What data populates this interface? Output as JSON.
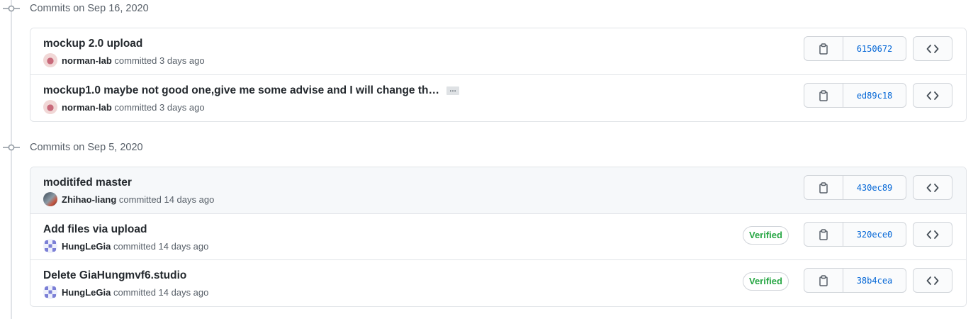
{
  "groups": [
    {
      "title": "Commits on Sep 16, 2020",
      "commits": [
        {
          "message": "mockup 2.0 upload",
          "has_ellipsis": false,
          "author": "norman-lab",
          "time": "committed 3 days ago",
          "avatar": "norman",
          "sha": "6150672",
          "verified": false,
          "highlight": false
        },
        {
          "message": "mockup1.0 maybe not good one,give me some advise and I will change th…",
          "has_ellipsis": true,
          "ellipsis_label": "…",
          "author": "norman-lab",
          "time": "committed 3 days ago",
          "avatar": "norman",
          "sha": "ed89c18",
          "verified": false,
          "highlight": false
        }
      ]
    },
    {
      "title": "Commits on Sep 5, 2020",
      "commits": [
        {
          "message": "moditifed master",
          "has_ellipsis": false,
          "author": "Zhihao-liang",
          "time": "committed 14 days ago",
          "avatar": "zhihao",
          "sha": "430ec89",
          "verified": false,
          "highlight": true
        },
        {
          "message": "Add files via upload",
          "has_ellipsis": false,
          "author": "HungLeGia",
          "time": "committed 14 days ago",
          "avatar": "hung",
          "sha": "320ece0",
          "verified": true,
          "verified_label": "Verified",
          "highlight": false
        },
        {
          "message": "Delete GiaHungmvf6.studio",
          "has_ellipsis": false,
          "author": "HungLeGia",
          "time": "committed 14 days ago",
          "avatar": "hung",
          "sha": "38b4cea",
          "verified": true,
          "verified_label": "Verified",
          "highlight": false
        }
      ]
    }
  ],
  "icons": {
    "commit": "git-commit-icon",
    "copy": "clipboard-icon",
    "browse": "code-icon"
  },
  "colors": {
    "sha_link": "#0366d6",
    "verified": "#28a745",
    "border": "#e1e4e8",
    "highlight_row": "#f6f8fa"
  }
}
